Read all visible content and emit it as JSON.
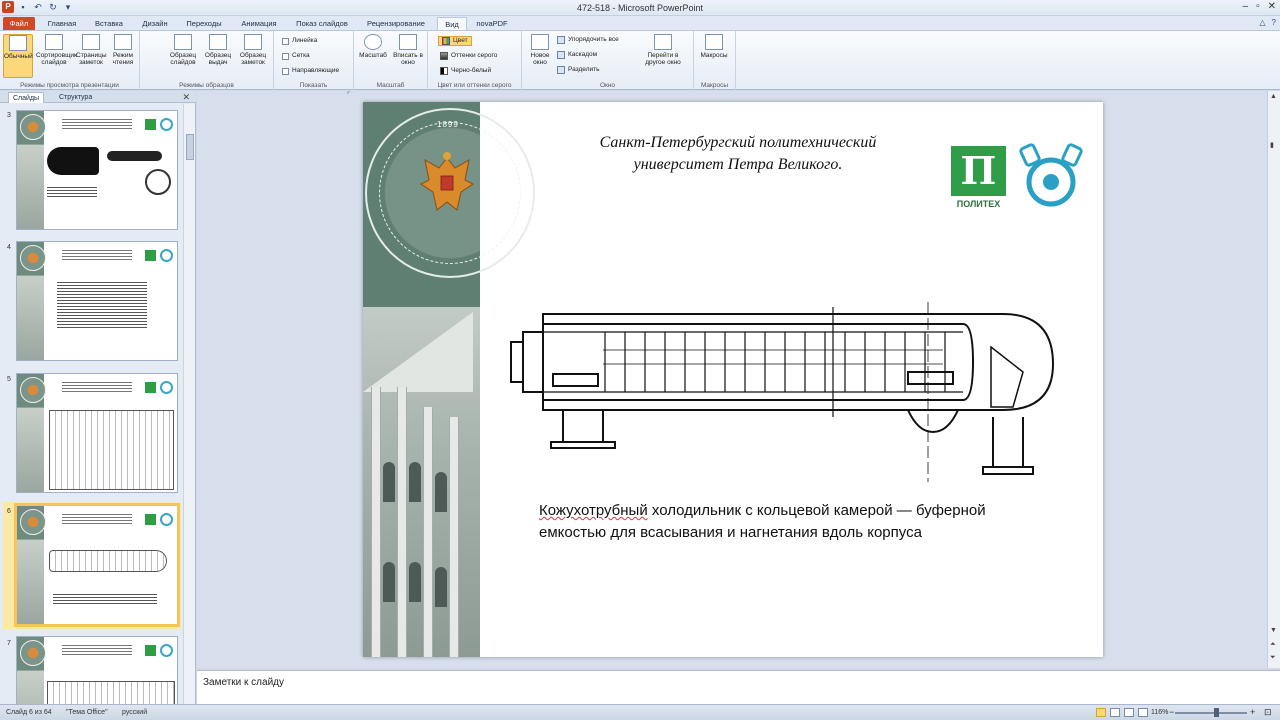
{
  "window": {
    "title": "472-518  -  Microsoft PowerPoint"
  },
  "quick_access": [
    "save-icon",
    "undo-icon",
    "redo-icon"
  ],
  "tabs": [
    {
      "label": "Файл"
    },
    {
      "label": "Главная"
    },
    {
      "label": "Вставка"
    },
    {
      "label": "Дизайн"
    },
    {
      "label": "Переходы"
    },
    {
      "label": "Анимация"
    },
    {
      "label": "Показ слайдов"
    },
    {
      "label": "Рецензирование"
    },
    {
      "label": "Вид"
    },
    {
      "label": "novaPDF"
    }
  ],
  "ribbon": {
    "presentation_views": {
      "label": "Режимы просмотра презентации",
      "normal": "Обычный",
      "sorter": "Сортировщик слайдов",
      "notes_page": "Страницы заметок",
      "reading": "Режим чтения"
    },
    "master_views": {
      "label": "Режимы образцов",
      "slide_master": "Образец слайдов",
      "handout_master": "Образец выдач",
      "notes_master": "Образец заметок"
    },
    "show": {
      "label": "Показать",
      "ruler": "Линейка",
      "grid": "Сетка",
      "guides": "Направляющие"
    },
    "zoom": {
      "label": "Масштаб",
      "zoom": "Масштаб",
      "fit": "Вписать в окно"
    },
    "color": {
      "label": "Цвет или оттенки серого",
      "color": "Цвет",
      "grayscale": "Оттенки серого",
      "bw": "Черно-белый"
    },
    "window": {
      "label": "Окно",
      "new_window": "Новое окно",
      "arrange_all": "Упорядочить все",
      "cascade": "Каскадом",
      "split": "Разделить",
      "switch": "Перейти в другое окно"
    },
    "macros": {
      "label": "Макросы",
      "macros": "Макросы"
    }
  },
  "left_panel": {
    "tab_slides": "Слайды",
    "tab_outline": "Структура",
    "slides": [
      {
        "num": "3"
      },
      {
        "num": "4"
      },
      {
        "num": "5"
      },
      {
        "num": "6"
      },
      {
        "num": "7"
      }
    ]
  },
  "slide": {
    "seal_year": "1899",
    "title": "Санкт-Петербургский политехнический университет Петра Великого.",
    "logo_text": "ПОЛИТЕХ",
    "logo_letter": "П",
    "caption_squiggle": "Кожухотрубный",
    "caption_rest": " холодильник с кольцевой камерой — буферной емкостью для всасывания и нагнетания вдоль корпуса"
  },
  "notes": {
    "placeholder": "Заметки к слайду"
  },
  "status": {
    "slide_info": "Слайд 6 из 64",
    "theme": "\"Тема Office\"",
    "language": "русский",
    "zoom": "116%"
  }
}
